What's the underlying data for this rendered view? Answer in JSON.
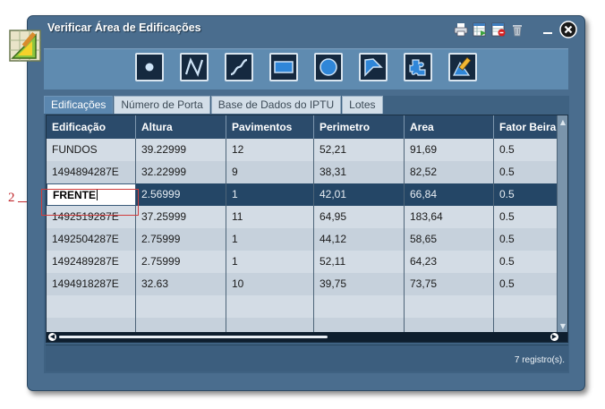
{
  "window": {
    "title": "Verificar Área de Edificações",
    "title_tools": [
      "print-icon",
      "export-table-icon",
      "delete-selection-icon",
      "trash-icon"
    ],
    "minimize": "minimize",
    "close": "close"
  },
  "toolbar": {
    "tools": [
      "point-tool",
      "polyline-tool",
      "curve-tool",
      "rectangle-tool",
      "circle-tool",
      "polygon-tool",
      "freehand-tool",
      "edit-tool"
    ]
  },
  "tabs": [
    {
      "label": "Edificações",
      "active": true
    },
    {
      "label": "Número de Porta",
      "active": false
    },
    {
      "label": "Base de Dados do IPTU",
      "active": false
    },
    {
      "label": "Lotes",
      "active": false
    }
  ],
  "table": {
    "columns": [
      "Edificação",
      "Altura",
      "Pavimentos",
      "Perimetro",
      "Area",
      "Fator Beira"
    ],
    "rows": [
      [
        "FUNDOS",
        "39.22999",
        "12",
        "52,21",
        "91,69",
        "0.5"
      ],
      [
        "1494894287E",
        "32.22999",
        "9",
        "38,31",
        "82,52",
        "0.5"
      ],
      [
        "FRENTE",
        "2.56999",
        "1",
        "42,01",
        "66,84",
        "0.5"
      ],
      [
        "1492519287E",
        "37.25999",
        "11",
        "64,95",
        "183,64",
        "0.5"
      ],
      [
        "1492504287E",
        "2.75999",
        "1",
        "44,12",
        "58,65",
        "0.5"
      ],
      [
        "1492489287E",
        "2.75999",
        "1",
        "52,11",
        "64,23",
        "0.5"
      ],
      [
        "1494918287E",
        "32.63",
        "10",
        "39,75",
        "73,75",
        "0.5"
      ]
    ],
    "selected_row": 2
  },
  "status": {
    "text": "7 registro(s)."
  },
  "annotation": {
    "label": "2"
  },
  "colors": {
    "window": "#4a6d8e",
    "header": "#2b4b6b",
    "selected_row": "#244666",
    "callout": "#c0282d"
  }
}
